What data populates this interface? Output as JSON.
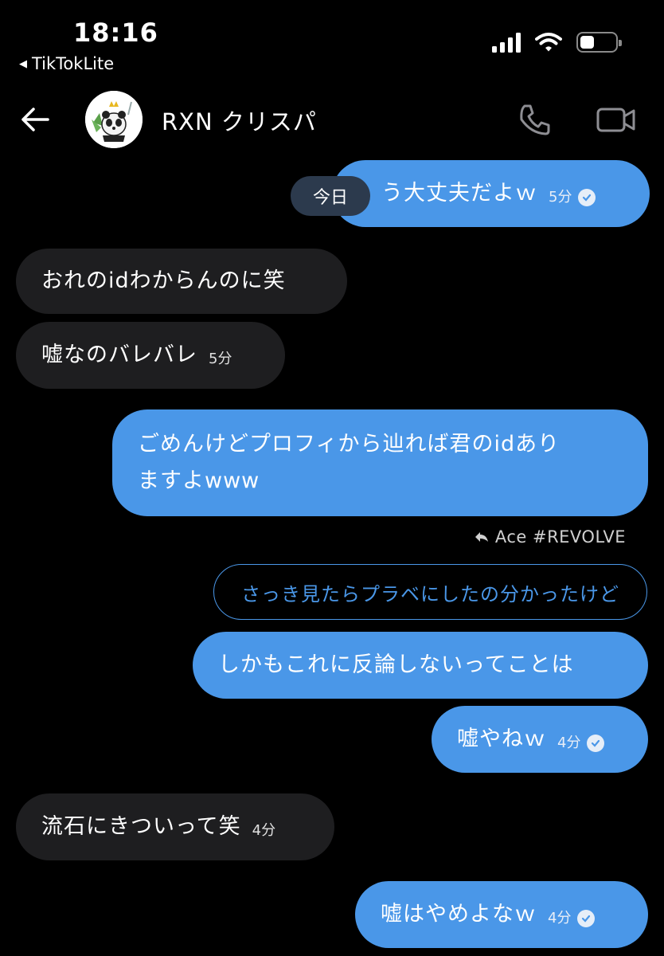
{
  "status_bar": {
    "time": "18:16",
    "back_app": "TikTokLite",
    "battery_level": 0.4
  },
  "header": {
    "contact_name": "RXN クリスパ"
  },
  "date_separator": "今日",
  "messages": [
    {
      "direction": "out",
      "text": "う大丈夫だよｗ",
      "time": "5分",
      "read": true
    },
    {
      "direction": "in",
      "text": "おれのidわからんのに笑",
      "time": ""
    },
    {
      "direction": "in",
      "text": "嘘なのバレバレ",
      "time": "5分"
    },
    {
      "direction": "out",
      "lines": [
        "ごめんけどプロフィから辿れば君のidあり",
        "ますよwww"
      ],
      "time": ""
    },
    {
      "direction": "out",
      "reply_to": "Ace #REVOLVE",
      "quoted": "さっき見たらプラベにしたの分かったけど",
      "text": "しかもこれに反論しないってことは",
      "time": ""
    },
    {
      "direction": "out",
      "text": "嘘やねｗ",
      "time": "4分",
      "read": true
    },
    {
      "direction": "in",
      "text": "流石にきついって笑",
      "time": "4分"
    },
    {
      "direction": "out",
      "text": "嘘はやめよなｗ",
      "time": "4分",
      "read": true
    }
  ],
  "colors": {
    "outgoing_bubble": "#4a97e8",
    "incoming_bubble": "#1e1e20",
    "background": "#000000"
  }
}
